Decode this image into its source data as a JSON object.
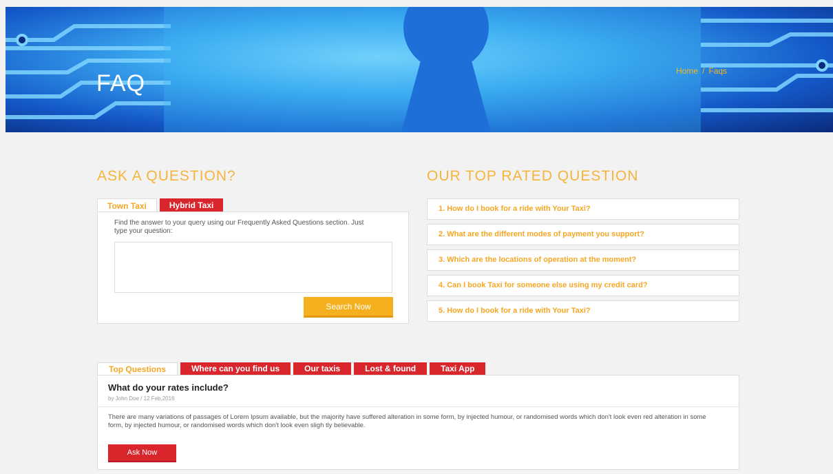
{
  "hero": {
    "title": "FAQ",
    "breadcrumb": [
      "Home",
      "Faqs"
    ],
    "breadcrumb_sep": "/"
  },
  "ask": {
    "heading": "ASK A QUESTION?",
    "tabs": [
      "Town Taxi",
      "Hybrid Taxi"
    ],
    "description": "Find the answer to your query using our Frequently Asked Questions section. Just type your question:",
    "textarea_value": "",
    "search_label": "Search Now"
  },
  "top": {
    "heading": "OUR TOP RATED QUESTION",
    "questions": [
      "1. How do I book for a ride with Your Taxi?",
      "2. What are the different modes of payment you support?",
      "3. Which are the locations of operation at the moment?",
      "4. Can I book Taxi for someone else using my credit card?",
      "5. How do I book for a ride with Your Taxi?"
    ]
  },
  "bottom": {
    "tabs": [
      "Top Questions",
      "Where can you find us",
      "Our taxis",
      "Lost & found",
      "Taxi App"
    ],
    "title": "What do your rates include?",
    "meta": "by John Doe / 12 Feb,2016",
    "body": "There are many variations of passages of Lorem Ipsum available, but the majority have suffered alteration in some form, by injected humour, or randomised words which don't look even red alteration in some form, by injected humour, or randomised words which don't look even sligh tly believable.",
    "ask_label": "Ask Now"
  },
  "colors": {
    "accent": "#f5b43c",
    "red": "#d9262c",
    "hero_blue": "#3aa8f0"
  }
}
